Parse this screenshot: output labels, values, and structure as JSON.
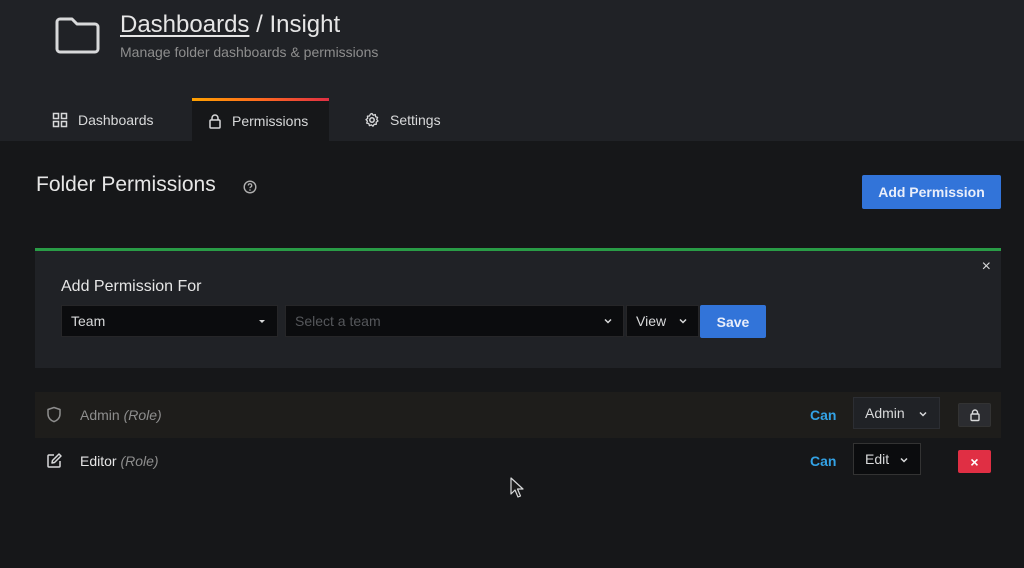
{
  "header": {
    "breadcrumb_link": "Dashboards",
    "separator": " / ",
    "folder_name": "Insight",
    "subtitle": "Manage folder dashboards & permissions",
    "icon": "folder-icon"
  },
  "tabs": [
    {
      "label": "Dashboards",
      "icon": "grid-icon",
      "active": false
    },
    {
      "label": "Permissions",
      "icon": "lock-icon",
      "active": true
    },
    {
      "label": "Settings",
      "icon": "gear-icon",
      "active": false
    }
  ],
  "main": {
    "title": "Folder Permissions",
    "add_button": "Add Permission"
  },
  "add_panel": {
    "heading": "Add Permission For",
    "type_value": "Team",
    "team_placeholder": "Select a team",
    "permission_value": "View",
    "save_label": "Save",
    "close_glyph": "×"
  },
  "permissions": [
    {
      "name": "Admin",
      "role": "(Role)",
      "can": "Can",
      "level": "Admin",
      "locked": true
    },
    {
      "name": "Editor",
      "role": "(Role)",
      "can": "Can",
      "level": "Edit",
      "locked": false,
      "remove_glyph": "×"
    }
  ],
  "colors": {
    "accent_blue": "#3274d9",
    "success_green": "#299c46",
    "danger_red": "#e02f44",
    "link_blue": "#33a2e5"
  }
}
